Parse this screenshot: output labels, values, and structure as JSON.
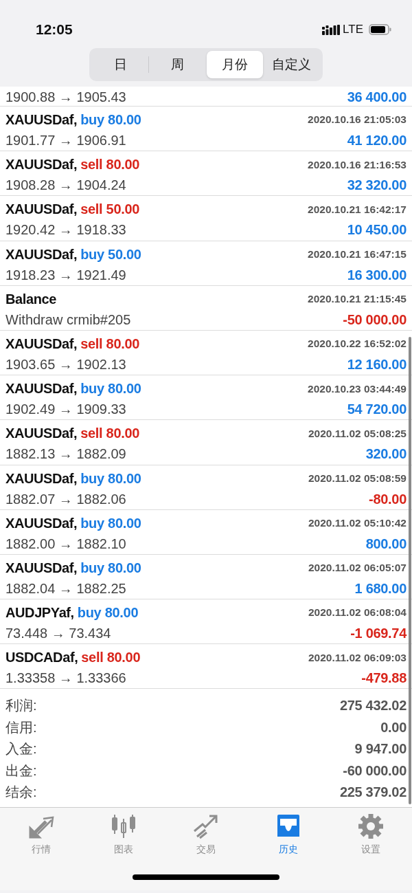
{
  "status_bar": {
    "time": "12:05",
    "network": "LTE"
  },
  "periods": [
    {
      "label": "日",
      "selected": false
    },
    {
      "label": "周",
      "selected": false
    },
    {
      "label": "月份",
      "selected": true
    },
    {
      "label": "自定义",
      "selected": false
    }
  ],
  "deals": [
    {
      "kind": "partial",
      "prices": "1900.88 → 1905.43",
      "profit": "36 400.00",
      "loss": false
    },
    {
      "kind": "buy",
      "symbol": "XAUUSDaf,",
      "side": "buy 80.00",
      "time": "2020.10.16 21:05:03",
      "prices": "1901.77 → 1906.91",
      "profit": "41 120.00",
      "loss": false
    },
    {
      "kind": "sell",
      "symbol": "XAUUSDaf,",
      "side": "sell 80.00",
      "time": "2020.10.16 21:16:53",
      "prices": "1908.28 → 1904.24",
      "profit": "32 320.00",
      "loss": false
    },
    {
      "kind": "sell",
      "symbol": "XAUUSDaf,",
      "side": "sell 50.00",
      "time": "2020.10.21 16:42:17",
      "prices": "1920.42 → 1918.33",
      "profit": "10 450.00",
      "loss": false
    },
    {
      "kind": "buy",
      "symbol": "XAUUSDaf,",
      "side": "buy 50.00",
      "time": "2020.10.21 16:47:15",
      "prices": "1918.23 → 1921.49",
      "profit": "16 300.00",
      "loss": false
    },
    {
      "kind": "balance",
      "symbol": "Balance",
      "time": "2020.10.21 21:15:45",
      "prices": "Withdraw crmib#205",
      "profit": "-50 000.00",
      "loss": true
    },
    {
      "kind": "sell",
      "symbol": "XAUUSDaf,",
      "side": "sell 80.00",
      "time": "2020.10.22 16:52:02",
      "prices": "1903.65 → 1902.13",
      "profit": "12 160.00",
      "loss": false
    },
    {
      "kind": "buy",
      "symbol": "XAUUSDaf,",
      "side": "buy 80.00",
      "time": "2020.10.23 03:44:49",
      "prices": "1902.49 → 1909.33",
      "profit": "54 720.00",
      "loss": false
    },
    {
      "kind": "sell",
      "symbol": "XAUUSDaf,",
      "side": "sell 80.00",
      "time": "2020.11.02 05:08:25",
      "prices": "1882.13 → 1882.09",
      "profit": "320.00",
      "loss": false
    },
    {
      "kind": "buy",
      "symbol": "XAUUSDaf,",
      "side": "buy 80.00",
      "time": "2020.11.02 05:08:59",
      "prices": "1882.07 → 1882.06",
      "profit": "-80.00",
      "loss": true
    },
    {
      "kind": "buy",
      "symbol": "XAUUSDaf,",
      "side": "buy 80.00",
      "time": "2020.11.02 05:10:42",
      "prices": "1882.00 → 1882.10",
      "profit": "800.00",
      "loss": false
    },
    {
      "kind": "buy",
      "symbol": "XAUUSDaf,",
      "side": "buy 80.00",
      "time": "2020.11.02 06:05:07",
      "prices": "1882.04 → 1882.25",
      "profit": "1 680.00",
      "loss": false
    },
    {
      "kind": "buy",
      "symbol": "AUDJPYaf,",
      "side": "buy 80.00",
      "time": "2020.11.02 06:08:04",
      "prices": "73.448 → 73.434",
      "profit": "-1 069.74",
      "loss": true
    },
    {
      "kind": "sell",
      "symbol": "USDCADaf,",
      "side": "sell 80.00",
      "time": "2020.11.02 06:09:03",
      "prices": "1.33358 → 1.33366",
      "profit": "-479.88",
      "loss": true
    }
  ],
  "summary": [
    {
      "label": "利润:",
      "value": "275 432.02"
    },
    {
      "label": "信用:",
      "value": "0.00"
    },
    {
      "label": "入金:",
      "value": "9 947.00"
    },
    {
      "label": "出金:",
      "value": "-60 000.00"
    },
    {
      "label": "结余:",
      "value": "225 379.02"
    }
  ],
  "tabs": [
    {
      "kind": "quotes",
      "label": "行情",
      "selected": false
    },
    {
      "kind": "chart",
      "label": "图表",
      "selected": false
    },
    {
      "kind": "trade",
      "label": "交易",
      "selected": false
    },
    {
      "kind": "history",
      "label": "历史",
      "selected": true
    },
    {
      "kind": "settings",
      "label": "设置",
      "selected": false
    }
  ]
}
